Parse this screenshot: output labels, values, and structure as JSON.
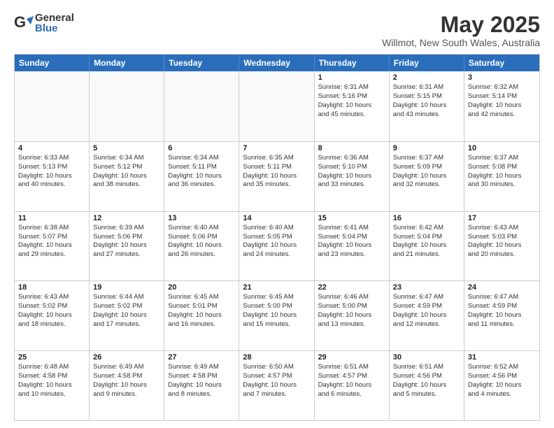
{
  "header": {
    "logo_general": "General",
    "logo_blue": "Blue",
    "month_title": "May 2025",
    "location": "Willmot, New South Wales, Australia"
  },
  "weekdays": [
    "Sunday",
    "Monday",
    "Tuesday",
    "Wednesday",
    "Thursday",
    "Friday",
    "Saturday"
  ],
  "weeks": [
    [
      {
        "day": "",
        "info": "",
        "empty": true
      },
      {
        "day": "",
        "info": "",
        "empty": true
      },
      {
        "day": "",
        "info": "",
        "empty": true
      },
      {
        "day": "",
        "info": "",
        "empty": true
      },
      {
        "day": "1",
        "info": "Sunrise: 6:31 AM\nSunset: 5:16 PM\nDaylight: 10 hours\nand 45 minutes."
      },
      {
        "day": "2",
        "info": "Sunrise: 6:31 AM\nSunset: 5:15 PM\nDaylight: 10 hours\nand 43 minutes."
      },
      {
        "day": "3",
        "info": "Sunrise: 6:32 AM\nSunset: 5:14 PM\nDaylight: 10 hours\nand 42 minutes."
      }
    ],
    [
      {
        "day": "4",
        "info": "Sunrise: 6:33 AM\nSunset: 5:13 PM\nDaylight: 10 hours\nand 40 minutes."
      },
      {
        "day": "5",
        "info": "Sunrise: 6:34 AM\nSunset: 5:12 PM\nDaylight: 10 hours\nand 38 minutes."
      },
      {
        "day": "6",
        "info": "Sunrise: 6:34 AM\nSunset: 5:11 PM\nDaylight: 10 hours\nand 36 minutes."
      },
      {
        "day": "7",
        "info": "Sunrise: 6:35 AM\nSunset: 5:11 PM\nDaylight: 10 hours\nand 35 minutes."
      },
      {
        "day": "8",
        "info": "Sunrise: 6:36 AM\nSunset: 5:10 PM\nDaylight: 10 hours\nand 33 minutes."
      },
      {
        "day": "9",
        "info": "Sunrise: 6:37 AM\nSunset: 5:09 PM\nDaylight: 10 hours\nand 32 minutes."
      },
      {
        "day": "10",
        "info": "Sunrise: 6:37 AM\nSunset: 5:08 PM\nDaylight: 10 hours\nand 30 minutes."
      }
    ],
    [
      {
        "day": "11",
        "info": "Sunrise: 6:38 AM\nSunset: 5:07 PM\nDaylight: 10 hours\nand 29 minutes."
      },
      {
        "day": "12",
        "info": "Sunrise: 6:39 AM\nSunset: 5:06 PM\nDaylight: 10 hours\nand 27 minutes."
      },
      {
        "day": "13",
        "info": "Sunrise: 6:40 AM\nSunset: 5:06 PM\nDaylight: 10 hours\nand 26 minutes."
      },
      {
        "day": "14",
        "info": "Sunrise: 6:40 AM\nSunset: 5:05 PM\nDaylight: 10 hours\nand 24 minutes."
      },
      {
        "day": "15",
        "info": "Sunrise: 6:41 AM\nSunset: 5:04 PM\nDaylight: 10 hours\nand 23 minutes."
      },
      {
        "day": "16",
        "info": "Sunrise: 6:42 AM\nSunset: 5:04 PM\nDaylight: 10 hours\nand 21 minutes."
      },
      {
        "day": "17",
        "info": "Sunrise: 6:43 AM\nSunset: 5:03 PM\nDaylight: 10 hours\nand 20 minutes."
      }
    ],
    [
      {
        "day": "18",
        "info": "Sunrise: 6:43 AM\nSunset: 5:02 PM\nDaylight: 10 hours\nand 18 minutes."
      },
      {
        "day": "19",
        "info": "Sunrise: 6:44 AM\nSunset: 5:02 PM\nDaylight: 10 hours\nand 17 minutes."
      },
      {
        "day": "20",
        "info": "Sunrise: 6:45 AM\nSunset: 5:01 PM\nDaylight: 10 hours\nand 16 minutes."
      },
      {
        "day": "21",
        "info": "Sunrise: 6:45 AM\nSunset: 5:00 PM\nDaylight: 10 hours\nand 15 minutes."
      },
      {
        "day": "22",
        "info": "Sunrise: 6:46 AM\nSunset: 5:00 PM\nDaylight: 10 hours\nand 13 minutes."
      },
      {
        "day": "23",
        "info": "Sunrise: 6:47 AM\nSunset: 4:59 PM\nDaylight: 10 hours\nand 12 minutes."
      },
      {
        "day": "24",
        "info": "Sunrise: 6:47 AM\nSunset: 4:59 PM\nDaylight: 10 hours\nand 11 minutes."
      }
    ],
    [
      {
        "day": "25",
        "info": "Sunrise: 6:48 AM\nSunset: 4:58 PM\nDaylight: 10 hours\nand 10 minutes."
      },
      {
        "day": "26",
        "info": "Sunrise: 6:49 AM\nSunset: 4:58 PM\nDaylight: 10 hours\nand 9 minutes."
      },
      {
        "day": "27",
        "info": "Sunrise: 6:49 AM\nSunset: 4:58 PM\nDaylight: 10 hours\nand 8 minutes."
      },
      {
        "day": "28",
        "info": "Sunrise: 6:50 AM\nSunset: 4:57 PM\nDaylight: 10 hours\nand 7 minutes."
      },
      {
        "day": "29",
        "info": "Sunrise: 6:51 AM\nSunset: 4:57 PM\nDaylight: 10 hours\nand 6 minutes."
      },
      {
        "day": "30",
        "info": "Sunrise: 6:51 AM\nSunset: 4:56 PM\nDaylight: 10 hours\nand 5 minutes."
      },
      {
        "day": "31",
        "info": "Sunrise: 6:52 AM\nSunset: 4:56 PM\nDaylight: 10 hours\nand 4 minutes."
      }
    ]
  ]
}
